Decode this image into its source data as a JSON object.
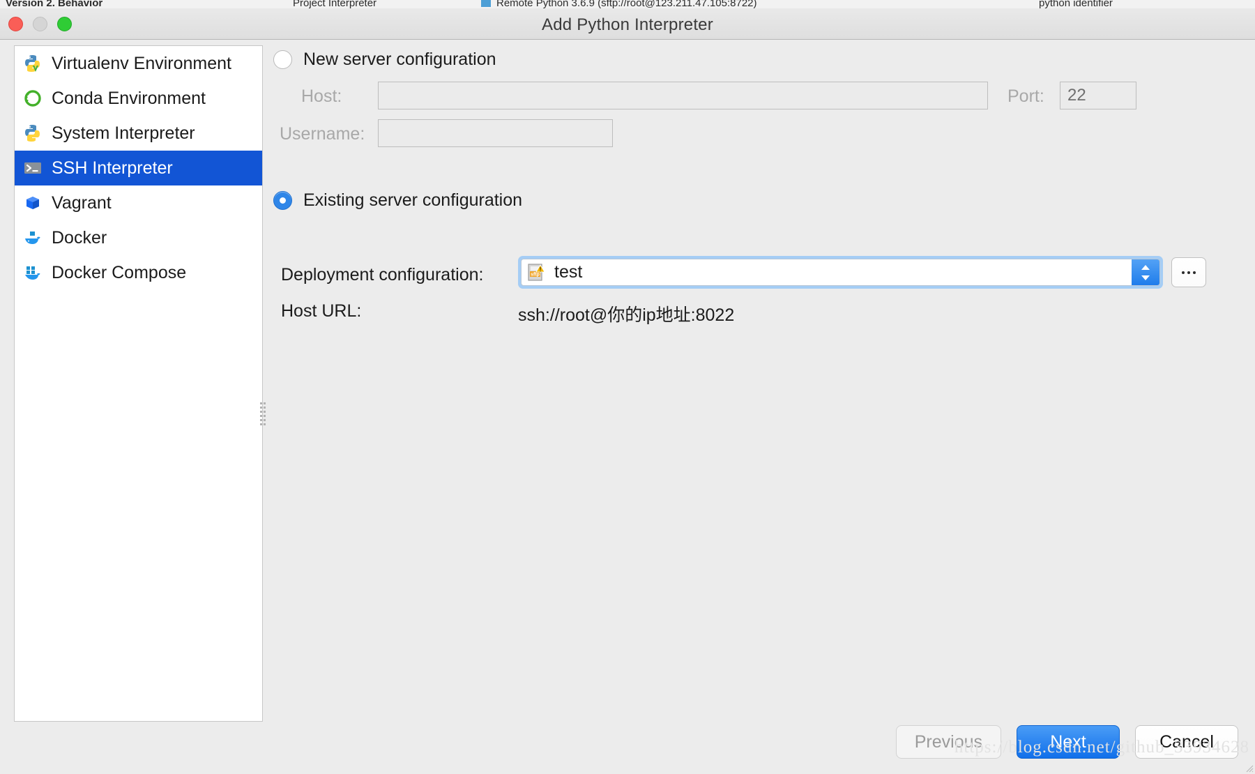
{
  "background": {
    "left_text": "Version 2. Behavior",
    "mid_text": "Project Interpreter",
    "right_text": "Remote Python 3.6.9 (sftp://root@123.211.47.105:8722)",
    "far_right_text": "python identifier"
  },
  "window": {
    "title": "Add Python Interpreter",
    "traffic_lights": [
      "close-button",
      "minimize-button",
      "maximize-button"
    ]
  },
  "sidebar": {
    "items": [
      {
        "label": "Virtualenv Environment",
        "icon": "python-virtualenv-icon",
        "selected": false
      },
      {
        "label": "Conda Environment",
        "icon": "conda-icon",
        "selected": false
      },
      {
        "label": "System Interpreter",
        "icon": "python-icon",
        "selected": false
      },
      {
        "label": "SSH Interpreter",
        "icon": "terminal-icon",
        "selected": true
      },
      {
        "label": "Vagrant",
        "icon": "vagrant-cube-icon",
        "selected": false
      },
      {
        "label": "Docker",
        "icon": "docker-whale-icon",
        "selected": false
      },
      {
        "label": "Docker Compose",
        "icon": "docker-compose-icon",
        "selected": false
      }
    ]
  },
  "form": {
    "new_server": {
      "radio_label": "New server configuration",
      "selected": false,
      "host_label": "Host:",
      "host_value": "",
      "host_placeholder": "",
      "port_label": "Port:",
      "port_value": "22",
      "username_label": "Username:",
      "username_value": "",
      "username_placeholder": ""
    },
    "existing_server": {
      "radio_label": "Existing server configuration",
      "selected": true,
      "deployment_label": "Deployment configuration:",
      "deployment_value": "test",
      "deployment_icon": "sftp-config-icon",
      "browse_label": "...",
      "host_url_label": "Host URL:",
      "host_url_value": "ssh://root@你的ip地址:8022"
    }
  },
  "footer": {
    "previous_label": "Previous",
    "next_label": "Next",
    "cancel_label": "Cancel"
  },
  "watermark": {
    "text": "https://blog.csdn.net/github_33934628"
  },
  "colors": {
    "selection_blue": "#1255d5",
    "accent_blue": "#2f86e8",
    "primary_button": "#1170ea",
    "dialog_bg": "#ececec",
    "panel_bg": "#ffffff"
  }
}
